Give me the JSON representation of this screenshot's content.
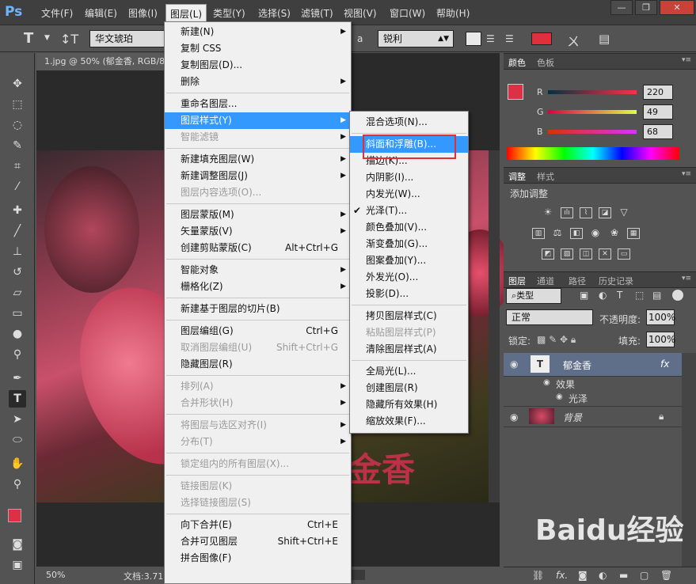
{
  "app": {
    "logo": "Ps"
  },
  "menubar": [
    "文件(F)",
    "编辑(E)",
    "图像(I)",
    "图层(L)",
    "类型(Y)",
    "选择(S)",
    "滤镜(T)",
    "视图(V)",
    "窗口(W)",
    "帮助(H)"
  ],
  "window_controls": [
    "—",
    "❐",
    "✕"
  ],
  "options": {
    "tool_glyph": "T",
    "font": "华文琥珀",
    "aa_label": "a",
    "aa_value": "锐利",
    "color": "#e0303c"
  },
  "document": {
    "tab": "1.jpg @ 50% (郁金香, RGB/8",
    "canvas_text": "金香",
    "zoom": "50%",
    "doc_info": "文档:3.71"
  },
  "layer_menu": [
    {
      "label": "新建(N)",
      "arrow": true
    },
    {
      "label": "复制 CSS"
    },
    {
      "label": "复制图层(D)..."
    },
    {
      "label": "删除",
      "arrow": true
    },
    {
      "sep": true
    },
    {
      "label": "重命名图层..."
    },
    {
      "label": "图层样式(Y)",
      "arrow": true,
      "highlight": true
    },
    {
      "label": "智能滤镜",
      "arrow": true,
      "disabled": true
    },
    {
      "sep": true
    },
    {
      "label": "新建填充图层(W)",
      "arrow": true
    },
    {
      "label": "新建调整图层(J)",
      "arrow": true
    },
    {
      "label": "图层内容选项(O)...",
      "disabled": true
    },
    {
      "sep": true
    },
    {
      "label": "图层蒙版(M)",
      "arrow": true
    },
    {
      "label": "矢量蒙版(V)",
      "arrow": true
    },
    {
      "label": "创建剪贴蒙版(C)",
      "shortcut": "Alt+Ctrl+G"
    },
    {
      "sep": true
    },
    {
      "label": "智能对象",
      "arrow": true
    },
    {
      "label": "栅格化(Z)",
      "arrow": true
    },
    {
      "sep": true
    },
    {
      "label": "新建基于图层的切片(B)"
    },
    {
      "sep": true
    },
    {
      "label": "图层编组(G)",
      "shortcut": "Ctrl+G"
    },
    {
      "label": "取消图层编组(U)",
      "shortcut": "Shift+Ctrl+G",
      "disabled": true
    },
    {
      "label": "隐藏图层(R)"
    },
    {
      "sep": true
    },
    {
      "label": "排列(A)",
      "arrow": true,
      "disabled": true
    },
    {
      "label": "合并形状(H)",
      "arrow": true,
      "disabled": true
    },
    {
      "sep": true
    },
    {
      "label": "将图层与选区对齐(I)",
      "arrow": true,
      "disabled": true
    },
    {
      "label": "分布(T)",
      "arrow": true,
      "disabled": true
    },
    {
      "sep": true
    },
    {
      "label": "锁定组内的所有图层(X)...",
      "disabled": true
    },
    {
      "sep": true
    },
    {
      "label": "链接图层(K)",
      "disabled": true
    },
    {
      "label": "选择链接图层(S)",
      "disabled": true
    },
    {
      "sep": true
    },
    {
      "label": "向下合并(E)",
      "shortcut": "Ctrl+E"
    },
    {
      "label": "合并可见图层",
      "shortcut": "Shift+Ctrl+E"
    },
    {
      "label": "拼合图像(F)"
    }
  ],
  "style_menu": [
    {
      "label": "混合选项(N)..."
    },
    {
      "sep": true
    },
    {
      "label": "斜面和浮雕(B)...",
      "highlight": true
    },
    {
      "label": "描边(K)..."
    },
    {
      "label": "内阴影(I)..."
    },
    {
      "label": "内发光(W)..."
    },
    {
      "label": "光泽(T)...",
      "checked": true
    },
    {
      "label": "颜色叠加(V)..."
    },
    {
      "label": "渐变叠加(G)..."
    },
    {
      "label": "图案叠加(Y)..."
    },
    {
      "label": "外发光(O)..."
    },
    {
      "label": "投影(D)..."
    },
    {
      "sep": true
    },
    {
      "label": "拷贝图层样式(C)"
    },
    {
      "label": "粘贴图层样式(P)",
      "disabled": true
    },
    {
      "label": "清除图层样式(A)"
    },
    {
      "sep": true
    },
    {
      "label": "全局光(L)..."
    },
    {
      "label": "创建图层(R)"
    },
    {
      "label": "隐藏所有效果(H)"
    },
    {
      "label": "缩放效果(F)..."
    }
  ],
  "color_panel": {
    "tabs": [
      "颜色",
      "色板"
    ],
    "sliders": [
      {
        "name": "R",
        "value": "220"
      },
      {
        "name": "G",
        "value": "49"
      },
      {
        "name": "B",
        "value": "68"
      }
    ],
    "swatch": "#dc3144"
  },
  "adjust_panel": {
    "tabs": [
      "调整",
      "样式"
    ],
    "title": "添加调整"
  },
  "layers_panel": {
    "tabs": [
      "图层",
      "通道",
      "路径",
      "历史记录"
    ],
    "filter": "类型",
    "blend": "正常",
    "opacity_label": "不透明度:",
    "opacity": "100%",
    "lock_label": "锁定:",
    "fill_label": "填充:",
    "fill": "100%",
    "layers": [
      {
        "name": "郁金香",
        "thumb": "T",
        "fx": "fx"
      },
      {
        "name": "效果"
      },
      {
        "name": "光泽"
      },
      {
        "name": "背景"
      }
    ]
  },
  "watermark": "Baidu经验"
}
